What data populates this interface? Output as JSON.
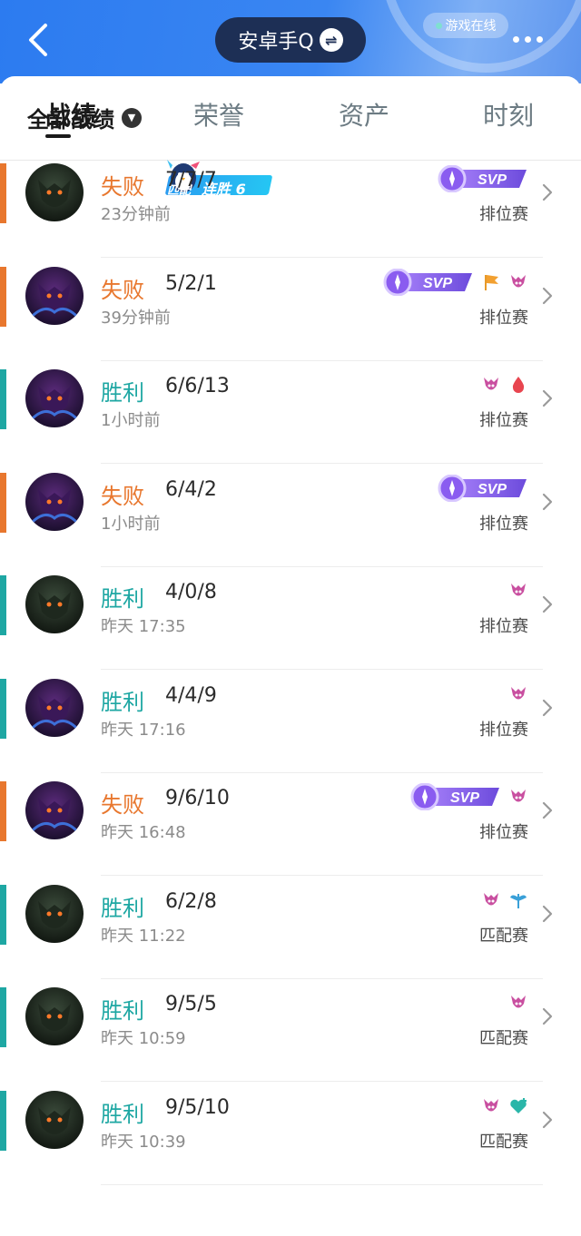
{
  "header": {
    "account_name": "安卓手Q",
    "online_status": "游戏在线",
    "accent_color": "#3a86f2"
  },
  "tabs": [
    {
      "label": "战绩",
      "active": true
    },
    {
      "label": "荣誉",
      "active": false
    },
    {
      "label": "资产",
      "active": false
    },
    {
      "label": "时刻",
      "active": false
    }
  ],
  "filter": {
    "label": "全部战绩",
    "streak_mode": "匹配",
    "streak_label": "连胜",
    "streak_count": "6"
  },
  "matches": [
    {
      "result": "失败",
      "kda": "7/7/7",
      "time": "23分钟前",
      "mode": "排位赛",
      "badges": [
        "svp-badge"
      ],
      "avatar": "dark"
    },
    {
      "result": "失败",
      "kda": "5/2/1",
      "time": "39分钟前",
      "mode": "排位赛",
      "badges": [
        "svp-badge",
        "flag-icon",
        "demon-icon"
      ],
      "avatar": "purple"
    },
    {
      "result": "胜利",
      "kda": "6/6/13",
      "time": "1小时前",
      "mode": "排位赛",
      "badges": [
        "demon-icon",
        "blood-drop-icon"
      ],
      "avatar": "purple"
    },
    {
      "result": "失败",
      "kda": "6/4/2",
      "time": "1小时前",
      "mode": "排位赛",
      "badges": [
        "svp-badge"
      ],
      "avatar": "purple"
    },
    {
      "result": "胜利",
      "kda": "4/0/8",
      "time": "昨天 17:35",
      "mode": "排位赛",
      "badges": [
        "demon-icon"
      ],
      "avatar": "dark"
    },
    {
      "result": "胜利",
      "kda": "4/4/9",
      "time": "昨天 17:16",
      "mode": "排位赛",
      "badges": [
        "demon-icon"
      ],
      "avatar": "purple"
    },
    {
      "result": "失败",
      "kda": "9/6/10",
      "time": "昨天 16:48",
      "mode": "排位赛",
      "badges": [
        "svp-badge",
        "demon-icon"
      ],
      "avatar": "purple"
    },
    {
      "result": "胜利",
      "kda": "6/2/8",
      "time": "昨天 11:22",
      "mode": "匹配赛",
      "badges": [
        "demon-icon",
        "wings-icon"
      ],
      "avatar": "dark"
    },
    {
      "result": "胜利",
      "kda": "9/5/5",
      "time": "昨天 10:59",
      "mode": "匹配赛",
      "badges": [
        "demon-icon"
      ],
      "avatar": "dark"
    },
    {
      "result": "胜利",
      "kda": "9/5/10",
      "time": "昨天 10:39",
      "mode": "匹配赛",
      "badges": [
        "demon-icon",
        "heart-plus-icon"
      ],
      "avatar": "dark"
    }
  ],
  "svp_text": "SVP",
  "colors": {
    "loss": "#e8772e",
    "win": "#1ea7a3",
    "svp": "#8a5cf0",
    "badge_pink": "#c94fa0"
  }
}
